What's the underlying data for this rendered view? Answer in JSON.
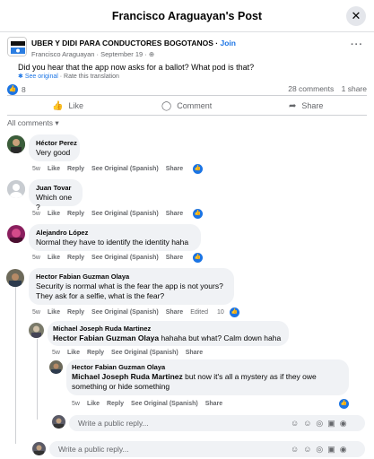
{
  "header": {
    "title": "Francisco Araguayan's Post",
    "close": "✕"
  },
  "post": {
    "group_name": "UBER Y DIDI PARA CONDUCTORES BOGOTANOS",
    "join": "Join",
    "author_meta": "Francisco Araguayan · September 19 · ",
    "text": "Did you hear that the app now asks for a ballot? What pod is that?",
    "see_original": "See original",
    "rate": " · Rate this translation",
    "like_count": "8",
    "comments_count": "28 comments",
    "shares_count": "1 share",
    "more": "···"
  },
  "actions": {
    "like": "Like",
    "comment": "Comment",
    "share": "Share"
  },
  "filter": "All comments",
  "comments": [
    {
      "author": "Héctor Perez",
      "text": "Very good",
      "actions": [
        "5w",
        "Like",
        "Reply",
        "See Original (Spanish)",
        "Share"
      ]
    },
    {
      "author": "Juan Tovar",
      "text": "Which one ?",
      "actions": [
        "5w",
        "Like",
        "Reply",
        "See Original (Spanish)",
        "Share"
      ]
    },
    {
      "author": "Alejandro López",
      "text": "Normal they have to identify the identity haha",
      "actions": [
        "5w",
        "Like",
        "Reply",
        "See Original (Spanish)",
        "Share"
      ]
    },
    {
      "author": "Hector Fabian Guzman Olaya",
      "text": "Security is normal what is the fear the app is not yours? They ask for a selfie, what is the fear?",
      "actions": [
        "5w",
        "Like",
        "Reply",
        "See Original (Spanish)",
        "Share",
        "Edited"
      ],
      "likes": "10"
    }
  ],
  "replies": [
    {
      "author": "Michael Joseph Ruda Martinez",
      "mention": "Hector Fabian Guzman Olaya",
      "text": " hahaha but what? Calm down haha",
      "actions": [
        "5w",
        "Like",
        "Reply",
        "See Original (Spanish)",
        "Share"
      ]
    },
    {
      "author": "Hector Fabian Guzman Olaya",
      "mention": "Michael Joseph Ruda Martinez",
      "text": " but now it's all a mystery as if they owe something or hide something",
      "actions": [
        "5w",
        "Like",
        "Reply",
        "See Original (Spanish)",
        "Share"
      ]
    }
  ],
  "reply_placeholder": "Write a public reply...",
  "write_placeholder": "Write a public reply...",
  "input_icons": [
    "☺",
    "☺",
    "◎",
    "▣",
    "◉"
  ]
}
